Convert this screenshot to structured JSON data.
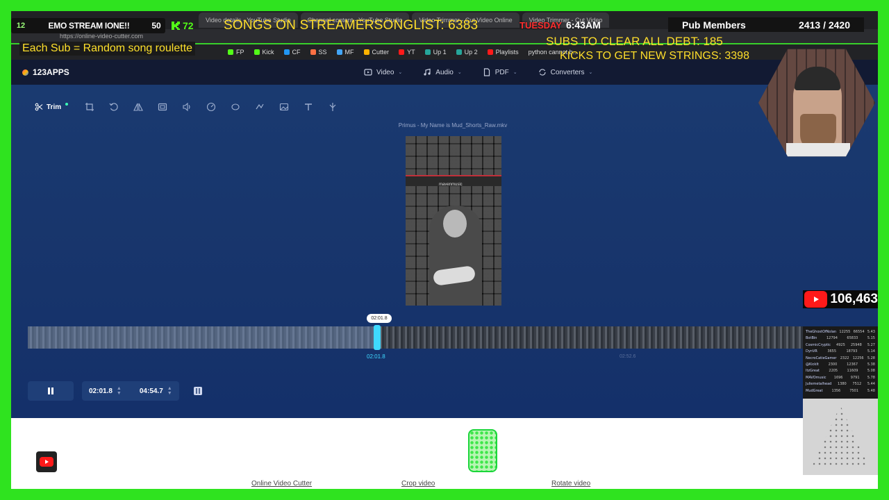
{
  "browser": {
    "tabs": [
      "Video details - YouTube Studio",
      "Channel content - YouTube Studio",
      "Video Trimmer - Cut Video Online",
      "Video Trimmer - Cut Video"
    ],
    "url": "https://online-video-cutter.com",
    "bookmarks": [
      {
        "label": "FP",
        "color": "#53fc18"
      },
      {
        "label": "Kick",
        "color": "#53fc18"
      },
      {
        "label": "CF",
        "color": "#2196f3"
      },
      {
        "label": "SS",
        "color": "#ff7043"
      },
      {
        "label": "MF",
        "color": "#42a5f5"
      },
      {
        "label": "Cutter",
        "color": "#ffb300"
      },
      {
        "label": "YT",
        "color": "#ff1a1a"
      },
      {
        "label": "Up 1",
        "color": "#26a69a"
      },
      {
        "label": "Up 2",
        "color": "#26a69a"
      },
      {
        "label": "Playlists",
        "color": "#ff1a1a"
      },
      {
        "label": "python cannot b...",
        "color": "#888888"
      }
    ]
  },
  "app": {
    "logo": "123APPS",
    "nav": [
      {
        "label": "Video",
        "icon": "video-icon"
      },
      {
        "label": "Audio",
        "icon": "audio-icon"
      },
      {
        "label": "PDF",
        "icon": "pdf-icon"
      },
      {
        "label": "Converters",
        "icon": "converters-icon"
      }
    ],
    "toolbar": {
      "active_tool": "Trim",
      "tools": [
        "crop-icon",
        "rotate-icon",
        "flip-icon",
        "resize-icon",
        "volume-icon",
        "speed-icon",
        "loop-icon",
        "stabilize-icon",
        "image-icon",
        "text-icon",
        "split-icon"
      ]
    },
    "filename": "Primus - My Name is Mud_Shorts_Raw.mkv",
    "preview_overlay_name": "mavenmusic",
    "timeline": {
      "cursor_bubble": "02:01.8",
      "start_label": "02:01.8",
      "end_label": "02:52.6"
    },
    "controls": {
      "start_time": "02:01.8",
      "end_time": "04:54.7"
    },
    "footer_links": [
      "Online Video Cutter",
      "Crop video",
      "Rotate video"
    ]
  },
  "overlay": {
    "level": "12",
    "stream_title": "EMO STREAM IONE!!",
    "stream_num": "50",
    "kick_count": "72",
    "songs_text": "SONGS ON STREAMERSONGLIST: 6383",
    "sub_text": "Each Sub = Random song roulette",
    "day": "TUESDAY",
    "time": "6:43AM",
    "pub_label": "Pub Members",
    "pub_count": "2413 / 2420",
    "debt_text": "SUBS TO CLEAR ALL DEBT: 185",
    "kicks_text": "KICKS TO GET NEW STRINGS: 3398",
    "youtube_subs": "106,463",
    "leaderboard": [
      {
        "name": "TheGhostOfNolan",
        "a": "12255",
        "b": "66554",
        "c": "5.43"
      },
      {
        "name": "BotBin",
        "a": "12794",
        "b": "65833",
        "c": "5.15"
      },
      {
        "name": "CosmicCryptic",
        "a": "4925",
        "b": "25948",
        "c": "5.27"
      },
      {
        "name": "DynVR",
        "a": "3655",
        "b": "18793",
        "c": "5.14"
      },
      {
        "name": "NecroCatieGamer",
        "a": "2322",
        "b": "12256",
        "c": "5.28"
      },
      {
        "name": "@KickIt",
        "a": "2300",
        "b": "12367",
        "c": "5.38"
      },
      {
        "name": "ItzGreat",
        "a": "2205",
        "b": "11609",
        "c": "5.08"
      },
      {
        "name": "MAVOmusic",
        "a": "1696",
        "b": "9791",
        "c": "5.78"
      },
      {
        "name": "Juliemetalhead",
        "a": "1380",
        "b": "7512",
        "c": "5.44"
      },
      {
        "name": "MudGreat",
        "a": "1356",
        "b": "7501",
        "c": "5.48"
      }
    ]
  },
  "colors": {
    "frame_green": "#2fe31f",
    "workspace_blue": "#17346b",
    "accent_cyan": "#3fd9ff",
    "overlay_yellow": "#ffde2b",
    "kick_green": "#53fc18",
    "youtube_red": "#ff1a1a"
  }
}
